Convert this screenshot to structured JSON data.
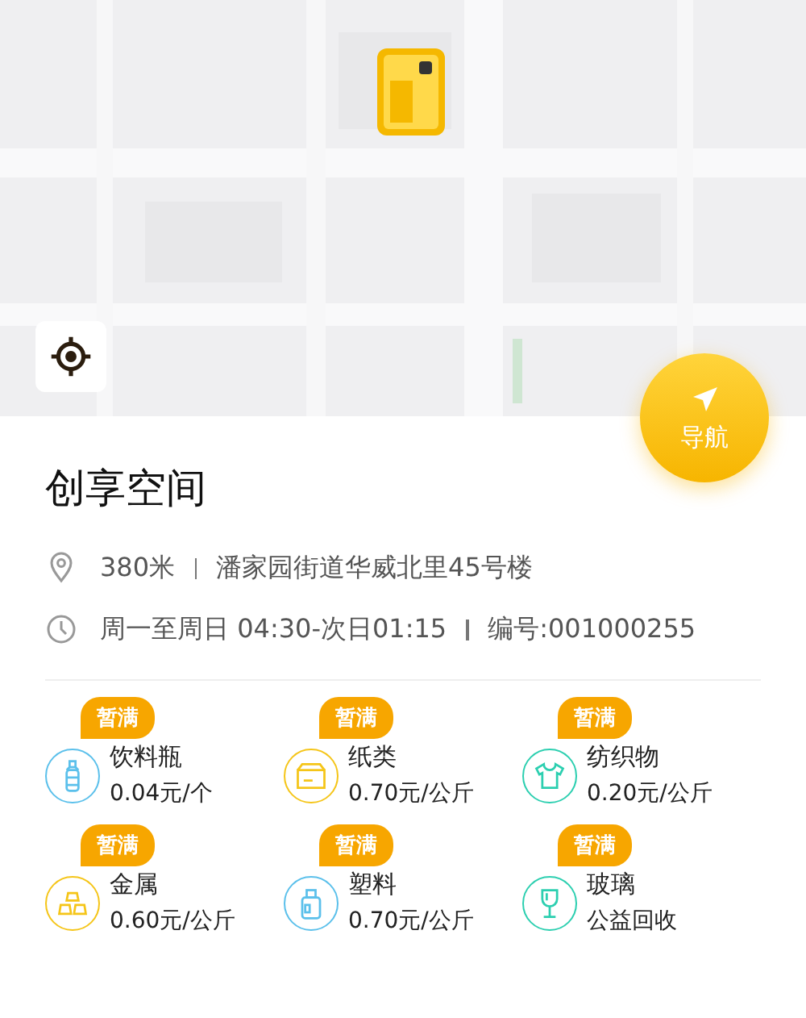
{
  "navigate_button": {
    "label": "导航"
  },
  "station": {
    "name": "创享空间",
    "distance": "380米",
    "address": "潘家园街道华威北里45号楼",
    "hours": "周一至周日 04:30-次日01:15",
    "number": "编号:001000255"
  },
  "categories": [
    {
      "kind": "bottle",
      "name": "饮料瓶",
      "price": "0.04元/个",
      "badge": "暂满",
      "color": "#5bc0eb"
    },
    {
      "kind": "paper",
      "name": "纸类",
      "price": "0.70元/公斤",
      "badge": "暂满",
      "color": "#f5c518"
    },
    {
      "kind": "textile",
      "name": "纺织物",
      "price": "0.20元/公斤",
      "badge": "暂满",
      "color": "#2ccfb0"
    },
    {
      "kind": "metal",
      "name": "金属",
      "price": "0.60元/公斤",
      "badge": "暂满",
      "color": "#f5c518"
    },
    {
      "kind": "plastic",
      "name": "塑料",
      "price": "0.70元/公斤",
      "badge": "暂满",
      "color": "#5bc0eb"
    },
    {
      "kind": "glass",
      "name": "玻璃",
      "price": "公益回收",
      "badge": "暂满",
      "color": "#2ccfb0"
    }
  ]
}
